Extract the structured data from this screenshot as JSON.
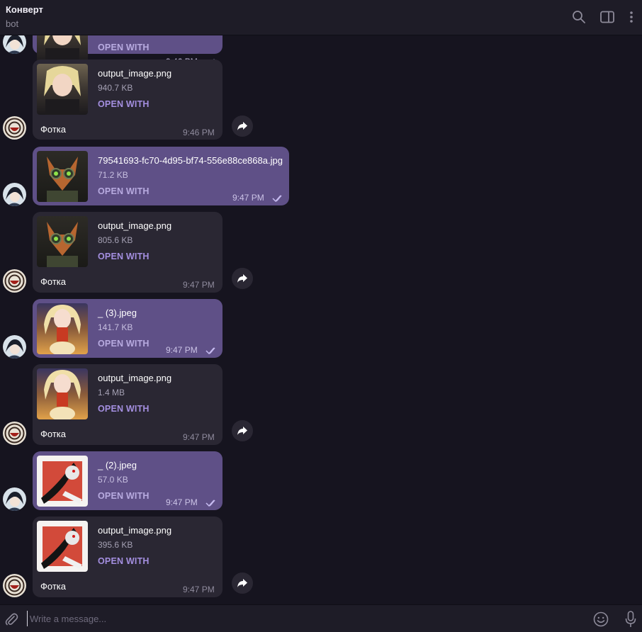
{
  "header": {
    "title": "Конверт",
    "status": "bot",
    "icons": [
      "search-icon",
      "sidebar-toggle-icon",
      "more-vertical-icon"
    ]
  },
  "messages": [
    {
      "direction": "outgoing",
      "filename": "",
      "size": "",
      "action": "OPEN WITH",
      "caption": "",
      "time": "9:46 PM",
      "read": true,
      "thumb": "anime-girl-dark"
    },
    {
      "direction": "incoming",
      "filename": "output_image.png",
      "size": "940.7 KB",
      "action": "OPEN WITH",
      "caption": "Фотка",
      "time": "9:46 PM",
      "thumb": "anime-girl-dark"
    },
    {
      "direction": "outgoing",
      "filename": "79541693-fc70-4d95-bf74-556e88ce868a.jpg",
      "size": "71.2 KB",
      "action": "OPEN WITH",
      "caption": "",
      "time": "9:47 PM",
      "read": true,
      "thumb": "fox-goggles"
    },
    {
      "direction": "incoming",
      "filename": "output_image.png",
      "size": "805.6 KB",
      "action": "OPEN WITH",
      "caption": "Фотка",
      "time": "9:47 PM",
      "thumb": "fox-goggles"
    },
    {
      "direction": "outgoing",
      "filename": "_ (3).jpeg",
      "size": "141.7 KB",
      "action": "OPEN WITH",
      "caption": "",
      "time": "9:47 PM",
      "read": true,
      "thumb": "anime-blonde-scarf"
    },
    {
      "direction": "incoming",
      "filename": "output_image.png",
      "size": "1.4 MB",
      "action": "OPEN WITH",
      "caption": "Фотка",
      "time": "9:47 PM",
      "thumb": "anime-blonde-scarf"
    },
    {
      "direction": "outgoing",
      "filename": "_ (2).jpeg",
      "size": "57.0 KB",
      "action": "OPEN WITH",
      "caption": "",
      "time": "9:47 PM",
      "read": true,
      "thumb": "red-white-sketch"
    },
    {
      "direction": "incoming",
      "filename": "output_image.png",
      "size": "395.6 KB",
      "action": "OPEN WITH",
      "caption": "Фотка",
      "time": "9:47 PM",
      "thumb": "red-white-sketch"
    }
  ],
  "composer": {
    "placeholder": "Write a message...",
    "icons": [
      "attach-icon",
      "emoji-icon",
      "microphone-icon"
    ]
  },
  "colors": {
    "background": "#16141f",
    "outgoing_bubble": "#5f5087",
    "incoming_bubble": "#2a2733",
    "accent": "#a48fe0"
  }
}
